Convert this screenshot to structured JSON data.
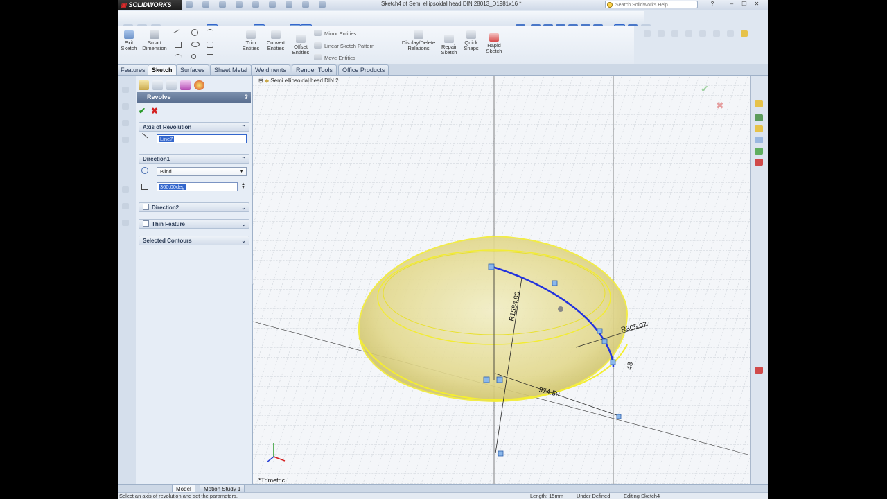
{
  "app": {
    "brand": "SOLIDWORKS",
    "document_title": "Sketch4 of Semi ellipsoidal head DIN 28013_D1981x16 *",
    "search_placeholder": "Search SolidWorks Help"
  },
  "command_manager": {
    "tools": [
      {
        "id": "exit-sketch",
        "label1": "Exit",
        "label2": "Sketch"
      },
      {
        "id": "smart-dimension",
        "label1": "Smart",
        "label2": "Dimension"
      },
      {
        "id": "trim-entities",
        "label1": "Trim",
        "label2": "Entities"
      },
      {
        "id": "convert-entities",
        "label1": "Convert",
        "label2": "Entities"
      },
      {
        "id": "offset-entities",
        "label1": "Offset",
        "label2": "Entities"
      },
      {
        "id": "display-delete-relations",
        "label1": "Display/Delete",
        "label2": "Relations"
      },
      {
        "id": "repair-sketch",
        "label1": "Repair",
        "label2": "Sketch"
      },
      {
        "id": "quick-snaps",
        "label1": "Quick",
        "label2": "Snaps"
      },
      {
        "id": "rapid-sketch",
        "label1": "Rapid",
        "label2": "Sketch"
      }
    ],
    "list_items": [
      "Mirror Entities",
      "Linear Sketch Pattern",
      "Move Entities"
    ]
  },
  "tabs": [
    "Features",
    "Sketch",
    "Surfaces",
    "Sheet Metal",
    "Weldments",
    "Render Tools",
    "Office Products"
  ],
  "active_tab": "Sketch",
  "property_manager": {
    "title": "Revolve",
    "help": "?",
    "ok_symbol": "✔",
    "cancel_symbol": "✖",
    "axis_section": "Axis of Revolution",
    "axis_value": "Line7",
    "direction1_section": "Direction1",
    "end_condition": "Blind",
    "angle_value": "360.00deg",
    "direction2_section": "Direction2",
    "thin_feature_section": "Thin Feature",
    "selected_contours_section": "Selected Contours"
  },
  "viewport": {
    "feature_tree_root": "Semi ellipsoidal head DIN 2...",
    "view_label": "*Trimetric",
    "dimensions": {
      "radius_large": "R1584.80",
      "radius_small": "R305.07",
      "length": "974.50",
      "height": "48"
    }
  },
  "bottom_tabs": [
    "Model",
    "Motion Study 1"
  ],
  "status": {
    "left": "Select an axis of revolution and set the parameters.",
    "length": "Length: 15mm",
    "state": "Under Defined",
    "editing": "Editing Sketch4"
  },
  "colors": {
    "accent": "#3366cc",
    "head_fill": "#e7df9a",
    "head_outline": "#f4ee3a",
    "profile_curve": "#2233dd"
  }
}
